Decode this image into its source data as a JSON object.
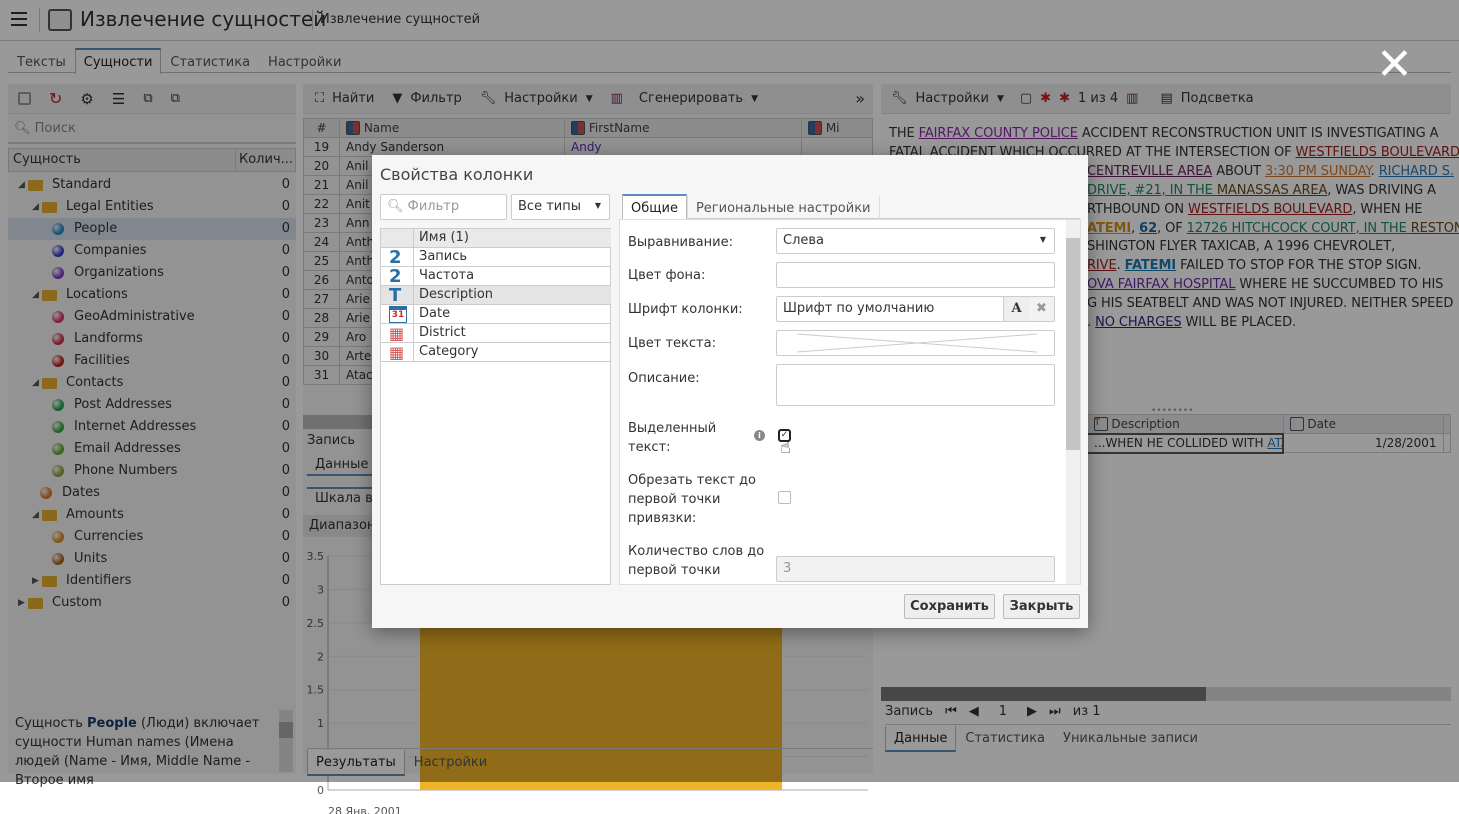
{
  "header": {
    "title": "Извлечение сущностей",
    "subtitle": "Извлечение сущностей"
  },
  "tabs": [
    "Тексты",
    "Сущности",
    "Статистика",
    "Настройки"
  ],
  "left": {
    "search_placeholder": "Поиск",
    "col_entity": "Сущность",
    "col_count": "Колич...",
    "tree": [
      {
        "label": "Standard",
        "level": 0,
        "kind": "folder",
        "expanded": true,
        "count": "0"
      },
      {
        "label": "Legal Entities",
        "level": 1,
        "kind": "folder",
        "expanded": true,
        "count": "0"
      },
      {
        "label": "People",
        "level": 2,
        "kind": "ball",
        "color": "#2a86c8",
        "count": "0",
        "selected": true
      },
      {
        "label": "Companies",
        "level": 2,
        "kind": "ball",
        "color": "#3a3ad0",
        "count": "0"
      },
      {
        "label": "Organizations",
        "level": 2,
        "kind": "ball",
        "color": "#7a3ac8",
        "count": "0"
      },
      {
        "label": "Locations",
        "level": 1,
        "kind": "folder",
        "expanded": true,
        "count": "0"
      },
      {
        "label": "GeoAdministrative",
        "level": 2,
        "kind": "ball",
        "color": "#d8306e",
        "count": "0"
      },
      {
        "label": "Landforms",
        "level": 2,
        "kind": "ball",
        "color": "#c83050",
        "count": "0"
      },
      {
        "label": "Facilities",
        "level": 2,
        "kind": "ball",
        "color": "#b82020",
        "count": "0"
      },
      {
        "label": "Contacts",
        "level": 1,
        "kind": "folder",
        "expanded": true,
        "count": "0"
      },
      {
        "label": "Post Addresses",
        "level": 2,
        "kind": "ball",
        "color": "#20a050",
        "count": "0"
      },
      {
        "label": "Internet Addresses",
        "level": 2,
        "kind": "ball",
        "color": "#30a838",
        "count": "0"
      },
      {
        "label": "Email Addresses",
        "level": 2,
        "kind": "ball",
        "color": "#60a830",
        "count": "0"
      },
      {
        "label": "Phone Numbers",
        "level": 2,
        "kind": "ball",
        "color": "#90a030",
        "count": "0"
      },
      {
        "label": "Dates",
        "level": 1,
        "kind": "ball",
        "color": "#e07828",
        "count": "0"
      },
      {
        "label": "Amounts",
        "level": 1,
        "kind": "folder",
        "expanded": true,
        "count": "0"
      },
      {
        "label": "Currencies",
        "level": 2,
        "kind": "ball",
        "color": "#d88a20",
        "count": "0"
      },
      {
        "label": "Units",
        "level": 2,
        "kind": "ball",
        "color": "#a86420",
        "count": "0"
      },
      {
        "label": "Identifiers",
        "level": 1,
        "kind": "folder",
        "expanded": false,
        "count": "0"
      },
      {
        "label": "Custom",
        "level": 0,
        "kind": "folder",
        "expanded": false,
        "count": "0"
      }
    ],
    "description": {
      "pre": "Сущность ",
      "bold": "People",
      "post": " (Люди) включает сущности Human names (Имена людей (Name - Имя, Middle Name - Второе имя"
    }
  },
  "middle": {
    "toolbar": {
      "find": "Найти",
      "filter": "Фильтр",
      "settings": "Настройки",
      "generate": "Сгенерировать",
      "more": "»"
    },
    "columns": [
      "#",
      "Name",
      "FirstName",
      "Mi"
    ],
    "rows": [
      [
        "19",
        "Andy Sanderson",
        "Andy"
      ],
      [
        "20",
        "Anil",
        ""
      ],
      [
        "21",
        "Anil",
        ""
      ],
      [
        "22",
        "Anit",
        ""
      ],
      [
        "23",
        "Ann",
        ""
      ],
      [
        "24",
        "Anth",
        ""
      ],
      [
        "25",
        "Anth",
        ""
      ],
      [
        "26",
        "Anto",
        ""
      ],
      [
        "27",
        "Arie",
        ""
      ],
      [
        "28",
        "Arie",
        ""
      ],
      [
        "29",
        "Aro",
        ""
      ],
      [
        "30",
        "Arte",
        ""
      ],
      [
        "31",
        "Atac",
        ""
      ]
    ],
    "record_label": "Запись",
    "tab_data": "Данные",
    "timeline": "Шкала вр",
    "range": "Диапазон",
    "bottom_tabs": [
      "Результаты",
      "Настройки"
    ]
  },
  "chart_data": {
    "type": "bar",
    "categories": [
      "28 Янв, 2001"
    ],
    "values": [
      3
    ],
    "ylim": [
      0,
      3.5
    ],
    "yticks": [
      "0",
      "0.5",
      "1",
      "1.5",
      "2",
      "2.5",
      "3",
      "3.5"
    ],
    "color": "#f0b428",
    "grid": true
  },
  "right": {
    "toolbar": {
      "settings": "Настройки",
      "counter": "1 из 4",
      "highlight": "Подсветка"
    },
    "lines": [
      [
        [
          "THE ",
          ""
        ],
        [
          "FAIRFAX COUNTY POLICE",
          "#8a2aa8"
        ],
        [
          " ACCIDENT RECONSTRUCTION UNIT IS INVESTIGATING A",
          ""
        ]
      ],
      [
        [
          "FATAL ACCIDENT",
          "#333"
        ],
        [
          " WHICH OCCURRED AT THE INTERSECTION OF ",
          ""
        ],
        [
          "WESTFIELDS BOULEVARD",
          "#a02020"
        ]
      ],
      [
        [
          "CENTREVILLE AREA",
          "#6a2060"
        ],
        [
          " ABOUT ",
          ""
        ],
        [
          "3:30 PM SUNDAY",
          "#d8782a"
        ],
        [
          ". ",
          ""
        ],
        [
          "RICHARD S.",
          "#2a7ab8"
        ]
      ],
      [
        [
          "DRIVE, #21, IN THE ",
          "#208a60"
        ],
        [
          "MANASSAS AREA",
          "#6a4a20"
        ],
        [
          ", WAS DRIVING A",
          ""
        ]
      ],
      [
        [
          "RTHBOUND ON ",
          ""
        ],
        [
          "WESTFIELDS BOULEVARD",
          "#a02020"
        ],
        [
          ", WHEN HE",
          ""
        ]
      ],
      [
        [
          "ATEMI",
          "#d8901a"
        ],
        [
          ", ",
          ""
        ],
        [
          "62",
          "#1a6aa8"
        ],
        [
          ", OF ",
          ""
        ],
        [
          "12726 HITCHCOCK COURT, IN THE ",
          "#208a60"
        ],
        [
          "RESTON",
          "#6a4a20"
        ]
      ],
      [
        [
          "SHINGTON FLYER TAXICAB, A 1996 CHEVROLET,",
          ""
        ]
      ],
      [
        [
          "RIVE",
          "#a02020"
        ],
        [
          ". ",
          ""
        ],
        [
          "FATEMI",
          "#1a7ab8"
        ],
        [
          " FAILED TO STOP FOR THE STOP SIGN.",
          ""
        ]
      ],
      [
        [
          "OVA FAIRFAX HOSPITAL",
          "#6a2aa8"
        ],
        [
          " WHERE HE SUCCUMBED TO HIS",
          ""
        ]
      ],
      [
        [
          "G HIS SEATBELT AND WAS NOT INJURED. NEITHER SPEED",
          ""
        ]
      ],
      [
        [
          ". ",
          ""
        ],
        [
          "NO CHARGES",
          "#2a2a80"
        ],
        [
          " WILL BE PLACED.",
          ""
        ]
      ]
    ],
    "table": {
      "col_desc": "Description",
      "col_date": "Date",
      "desc": "...WHEN HE COLLIDED WITH ",
      "desc_link": "ATAC",
      "date": "1/28/2001"
    },
    "record_label": "Запись",
    "page": "1",
    "of": "из 1",
    "tabs": [
      "Данные",
      "Статистика",
      "Уникальные записи"
    ]
  },
  "dialog": {
    "title": "Свойства колонки",
    "filter_placeholder": "Фильтр",
    "type_select": "Все типы",
    "list_header": "Имя (1)",
    "fields": [
      {
        "name": "Запись",
        "type": "number"
      },
      {
        "name": "Частота",
        "type": "number"
      },
      {
        "name": "Description",
        "type": "text",
        "selected": true
      },
      {
        "name": "Date",
        "type": "date"
      },
      {
        "name": "District",
        "type": "category"
      },
      {
        "name": "Category",
        "type": "category"
      }
    ],
    "tabs": [
      "Общие",
      "Региональные настройки"
    ],
    "form": {
      "align_label": "Выравнивание:",
      "align_value": "Слева",
      "bg_label": "Цвет фона:",
      "font_label": "Шрифт колонки:",
      "font_value": "Шрифт по умолчанию",
      "text_color_label": "Цвет текста:",
      "desc_label": "Описание:",
      "highlight_label": "Выделенный текст:",
      "highlight_checked": true,
      "trim_label": "Обрезать текст до первой точки привязки:",
      "trim_checked": false,
      "words_label": "Количество слов до первой точки",
      "words_value": "3"
    },
    "save": "Сохранить",
    "close": "Закрыть"
  }
}
